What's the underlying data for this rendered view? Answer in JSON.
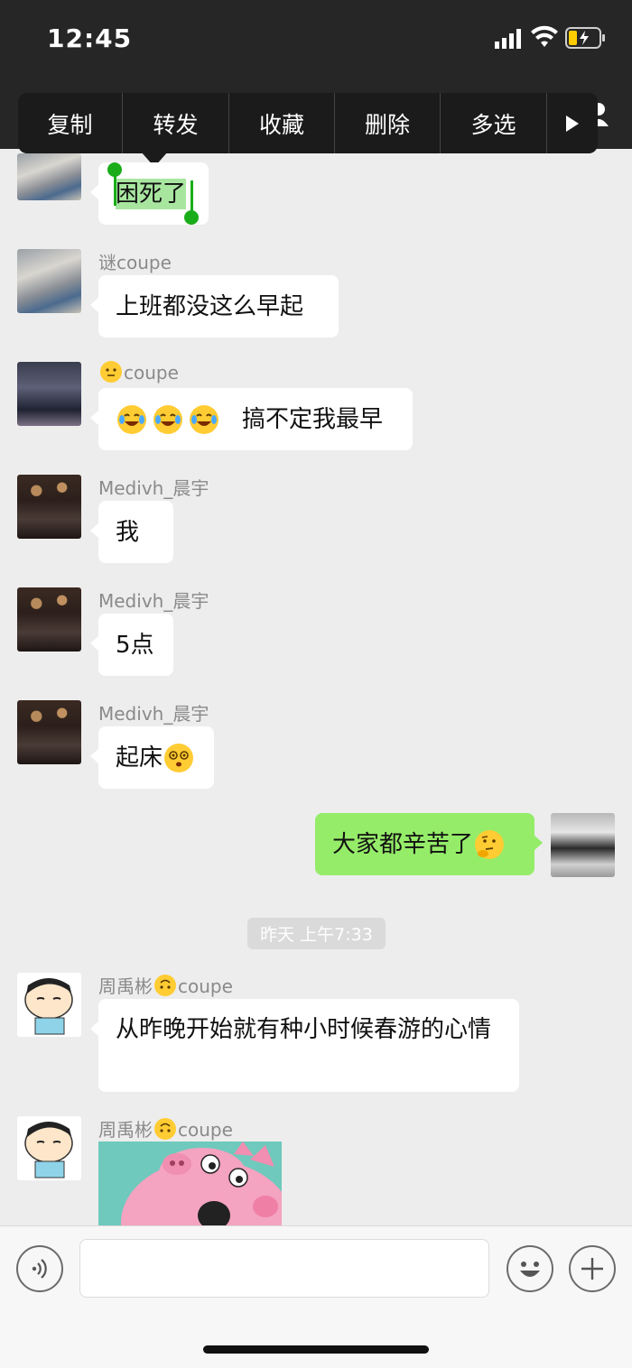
{
  "status_bar": {
    "time": "12:45"
  },
  "context_menu": {
    "items": [
      "复制",
      "转发",
      "收藏",
      "删除",
      "多选"
    ],
    "more_icon": "play-arrow-icon"
  },
  "messages": [
    {
      "sender": "",
      "text": "困死了",
      "selected": true
    },
    {
      "sender": "谜coupe",
      "text": "上班都没这么早起"
    },
    {
      "sender": "coupe",
      "sender_emoji": "slightly-smiling-face-icon",
      "emojis": [
        "laugh-tears-icon",
        "laugh-tears-icon",
        "laugh-tears-icon"
      ],
      "text": "搞不定我最早"
    },
    {
      "sender": "Medivh_晨宇",
      "text": "我"
    },
    {
      "sender": "Medivh_晨宇",
      "text": "5点"
    },
    {
      "sender": "Medivh_晨宇",
      "text": "起床",
      "trailing_emoji": "dizzy-face-icon"
    },
    {
      "sender": "self",
      "text": "大家都辛苦了",
      "trailing_emoji": "thinking-face-icon"
    },
    {
      "sender": "周禹彬",
      "sender_suffix": "coupe",
      "sender_emoji": "upside-down-face-icon",
      "text": "从昨晚开始就有种小时候春游的心情"
    },
    {
      "sender": "周禹彬",
      "sender_suffix": "coupe",
      "sender_emoji": "upside-down-face-icon",
      "image": "peppa-pig-sticker"
    }
  ],
  "timestamp": "昨天 上午7:33",
  "input_bar": {
    "voice_icon": "voice-icon",
    "emoji_icon": "emoji-face-icon",
    "plus_icon": "plus-icon",
    "value": ""
  },
  "colors": {
    "self_bubble": "#95ec69",
    "selection": "#1aad19",
    "background": "#ededed"
  }
}
